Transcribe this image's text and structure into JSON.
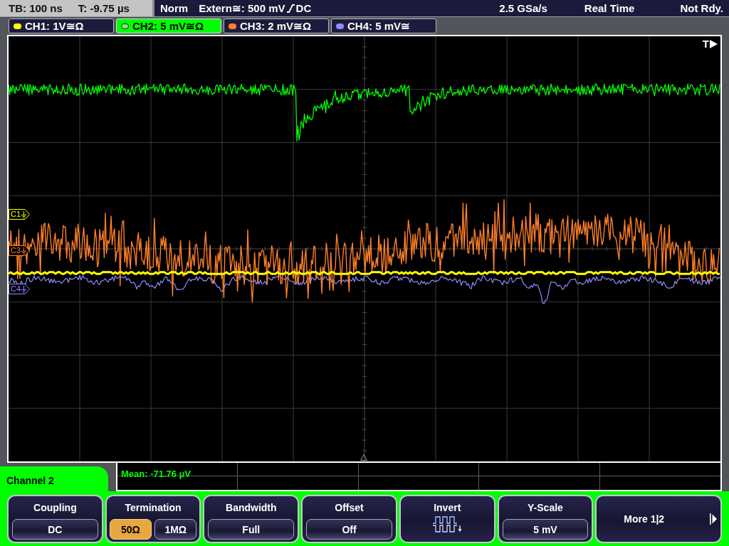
{
  "status_bar": {
    "timebase": "TB: 100 ns",
    "trigger_time": "T: -9.75 µs",
    "trigger_mode": "Norm",
    "trigger_source": "Extern≅: 500 mV",
    "trigger_rising": true,
    "trigger_coupling": "DC",
    "sample_rate": "2.5 GSa/s",
    "acquisition": "Real Time",
    "status": "Not Rdy."
  },
  "channels": [
    {
      "label": "CH1: 1V≅Ω",
      "color": "#ffff00",
      "selected": false
    },
    {
      "label": "CH2: 5 mV≅Ω",
      "color": "#00ff00",
      "selected": true
    },
    {
      "label": "CH3: 2 mV≅Ω",
      "color": "#ff7f27",
      "selected": false
    },
    {
      "label": "CH4: 5 mV≅",
      "color": "#8c8cff",
      "selected": false
    }
  ],
  "screen": {
    "trigger_label": "T",
    "markers": [
      {
        "label": "C1",
        "color": "#ffff00"
      },
      {
        "label": "C3",
        "color": "#ff7f27"
      },
      {
        "label": "C4",
        "color": "#8c8cff"
      }
    ],
    "measurement": "Mean: -71.76 µV"
  },
  "menu": {
    "title": "Channel 2",
    "softkeys": [
      {
        "kind": "value",
        "label": "Coupling",
        "value": "DC"
      },
      {
        "kind": "options",
        "label": "Termination",
        "options": [
          {
            "label": "50Ω",
            "selected": true
          },
          {
            "label": "1MΩ",
            "selected": false
          }
        ]
      },
      {
        "kind": "value",
        "label": "Bandwidth",
        "value": "Full"
      },
      {
        "kind": "value",
        "label": "Offset",
        "value": "Off"
      },
      {
        "kind": "icon",
        "label": "Invert"
      },
      {
        "kind": "value",
        "label": "Y-Scale",
        "value": "5 mV"
      },
      {
        "kind": "more",
        "label": "More 1|2"
      }
    ]
  }
}
